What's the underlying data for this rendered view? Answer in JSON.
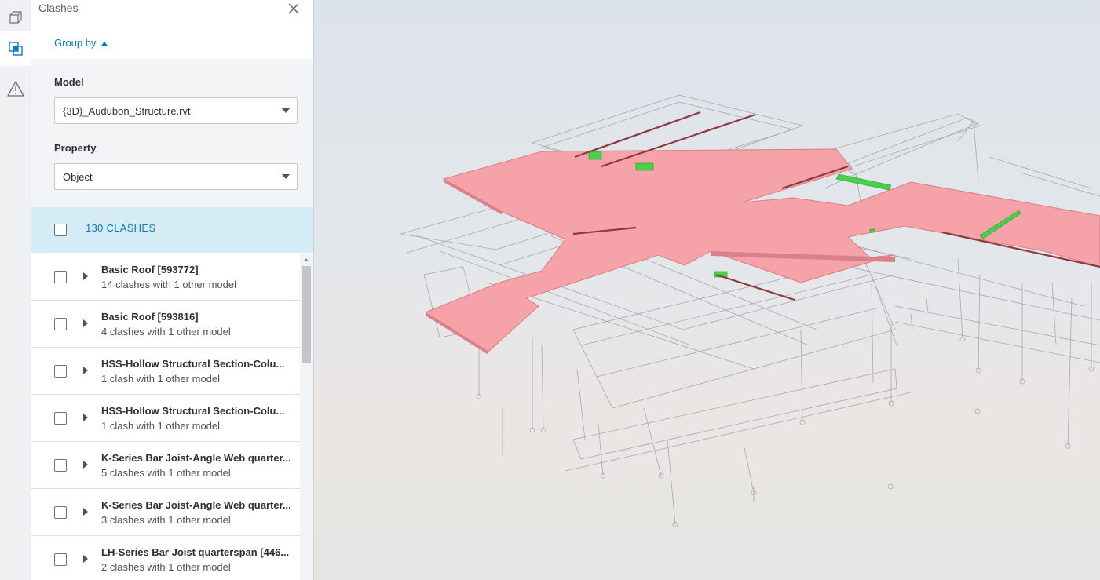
{
  "app": {
    "rail": {
      "items": [
        {
          "icon": "model-cube-icon"
        },
        {
          "icon": "clashes-overlap-icon",
          "active": true
        },
        {
          "icon": "warning-triangle-icon"
        }
      ]
    }
  },
  "panel": {
    "title": "Clashes",
    "close_icon": "close-icon",
    "group_by_label": "Group by",
    "model_label": "Model",
    "model_value": "{3D}_Audubon_Structure.rvt",
    "property_label": "Property",
    "property_value": "Object",
    "summary": "130 CLASHES"
  },
  "clash_list": [
    {
      "title": "Basic Roof [593772]",
      "subtitle": "14 clashes with 1 other model"
    },
    {
      "title": "Basic Roof [593816]",
      "subtitle": "4 clashes with 1 other model"
    },
    {
      "title": "HSS-Hollow Structural Section-Colu...",
      "subtitle": "1 clash with 1 other model"
    },
    {
      "title": "HSS-Hollow Structural Section-Colu...",
      "subtitle": "1 clash with 1 other model"
    },
    {
      "title": "K-Series Bar Joist-Angle Web quarter...",
      "subtitle": "5 clashes with 1 other model"
    },
    {
      "title": "K-Series Bar Joist-Angle Web quarter...",
      "subtitle": "3 clashes with 1 other model"
    },
    {
      "title": "LH-Series Bar Joist quarterspan [446...",
      "subtitle": "2 clashes with 1 other model"
    }
  ],
  "colors": {
    "accent": "#0a7bbd",
    "summary_bg": "#d5ecf7",
    "clash_red": "#f5a3a8",
    "clash_green": "#45d14a"
  }
}
